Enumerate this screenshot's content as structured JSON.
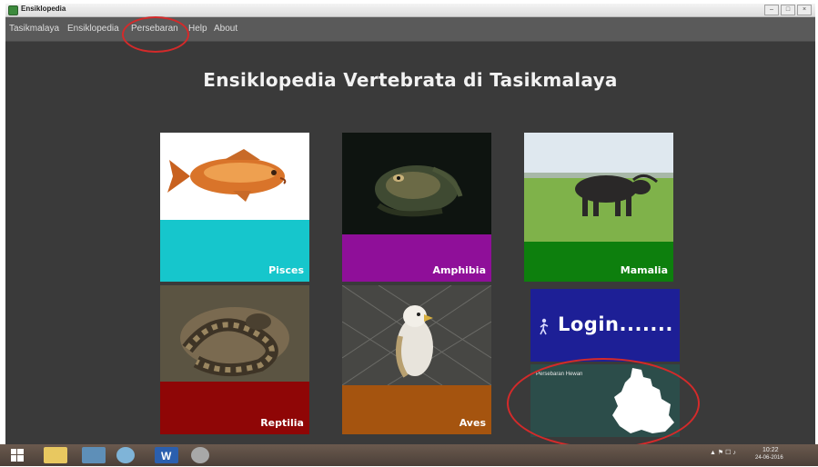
{
  "window": {
    "title": "Ensiklopedia",
    "controls": [
      "–",
      "□",
      "×"
    ]
  },
  "menu": {
    "items": [
      "Tasikmalaya",
      "Ensiklopedia",
      "Persebaran",
      "Help",
      "About"
    ],
    "highlighted": "Persebaran"
  },
  "heading": "Ensiklopedia Vertebrata di Tasikmalaya",
  "tiles": [
    {
      "label": "Pisces",
      "color": "#16c6cc"
    },
    {
      "label": "Amphibia",
      "color": "#8f0f99"
    },
    {
      "label": "Mamalia",
      "color": "#0d7f0d"
    },
    {
      "label": "Reptilia",
      "color": "#8f0606"
    },
    {
      "label": "Aves",
      "color": "#a5540f"
    }
  ],
  "login": {
    "label": "Login.......",
    "icon": "walking-person-icon",
    "color": "#1d1f96"
  },
  "map_tile": {
    "label": "Persebaran Hewan",
    "icon": "region-map-icon",
    "color": "#2c4d4a"
  },
  "annotation_color": "#d42a2a",
  "taskbar": {
    "icons": [
      "windows-start-icon",
      "file-explorer-icon",
      "photo-viewer-icon",
      "browser-icon",
      "word-icon",
      "paint-icon"
    ],
    "clock_time": "10:22",
    "clock_date": "24-06-2016"
  }
}
